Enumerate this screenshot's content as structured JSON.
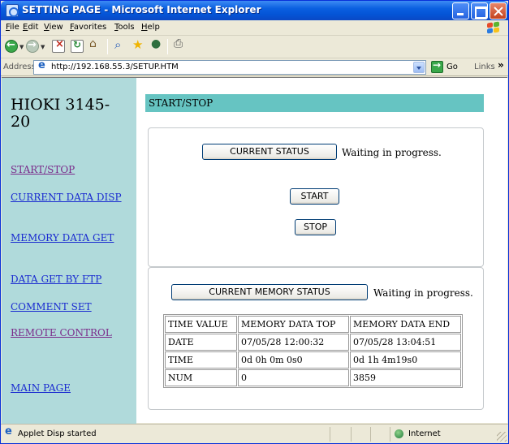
{
  "window": {
    "title": "SETTING PAGE - Microsoft Internet Explorer"
  },
  "menu": [
    "File",
    "Edit",
    "View",
    "Favorites",
    "Tools",
    "Help"
  ],
  "address": {
    "label": "Address",
    "url": "http://192.168.55.3/SETUP.HTM",
    "go_label": "Go",
    "links_label": "Links",
    "links_chevron": "»"
  },
  "sidebar": {
    "title": "HIOKI 3145-20",
    "links": [
      {
        "label": "START/STOP",
        "visited": true
      },
      {
        "label": "CURRENT DATA DISP",
        "visited": false
      },
      {
        "label": "MEMORY DATA GET",
        "visited": false
      },
      {
        "label": "DATA GET BY FTP",
        "visited": false
      },
      {
        "label": "COMMENT SET",
        "visited": false
      },
      {
        "label": "REMOTE CONTROL",
        "visited": true
      },
      {
        "label": "MAIN PAGE",
        "visited": false
      }
    ]
  },
  "main": {
    "header": "START/STOP",
    "current_status_button": "CURRENT STATUS",
    "current_status_text": "Waiting in progress.",
    "start_button": "START",
    "stop_button": "STOP",
    "memory_status_button": "CURRENT MEMORY STATUS",
    "memory_status_text": "Waiting in progress.",
    "table": {
      "headers": [
        "TIME VALUE",
        "MEMORY DATA TOP",
        "MEMORY DATA END"
      ],
      "rows": [
        [
          "DATE",
          "07/05/28 12:00:32",
          "07/05/28 13:04:51"
        ],
        [
          "TIME",
          "0d 0h 0m 0s0",
          "0d 1h 4m19s0"
        ],
        [
          "NUM",
          "0",
          "3859"
        ]
      ]
    }
  },
  "statusbar": {
    "text": "Applet Disp started",
    "zone": "Internet"
  },
  "colors": {
    "sidebar_bg": "#b0dadb",
    "header_bg": "#66c4c2",
    "link": "#1a2bd0",
    "visited_link": "#7a2a8a"
  }
}
